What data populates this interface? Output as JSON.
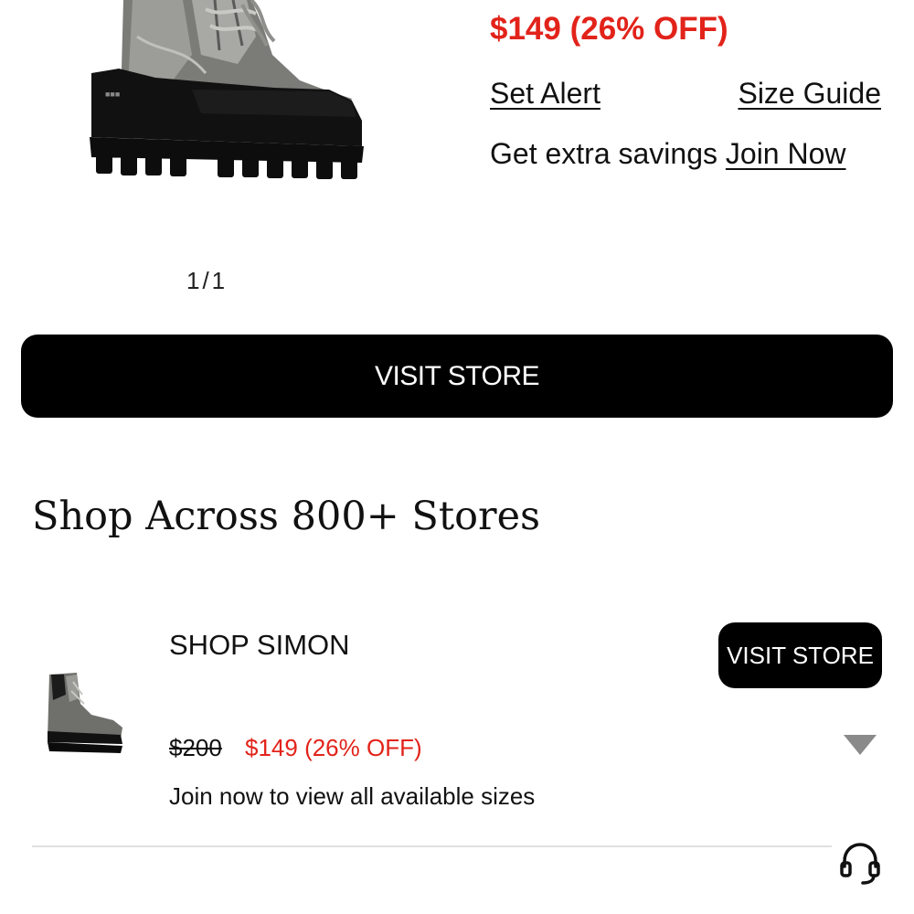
{
  "product": {
    "price_now": "$149 (26% OFF)",
    "set_alert": "Set Alert",
    "size_guide": "Size Guide",
    "extra_savings_text": "Get extra savings",
    "join_now": "Join Now",
    "image_counter": "1/1",
    "image_icon": "boot-product-image"
  },
  "cta": {
    "visit_store": "VISIT STORE"
  },
  "stores_section": {
    "title": "Shop Across 800+ Stores",
    "stores": [
      {
        "name": "SHOP SIMON",
        "visit_label": "VISIT STORE",
        "old_price": "$200",
        "sale_price": "$149 (26% OFF)",
        "sizes_note": "Join now to view all available sizes",
        "thumb_icon": "boot-thumbnail"
      }
    ]
  },
  "icons": {
    "dropdown": "triangle-down-icon",
    "support": "headset-icon"
  },
  "colors": {
    "sale_red": "#e2231a",
    "button_black": "#000000",
    "divider": "#e0e0e0",
    "dropdown_gray": "#8a8a8a"
  }
}
